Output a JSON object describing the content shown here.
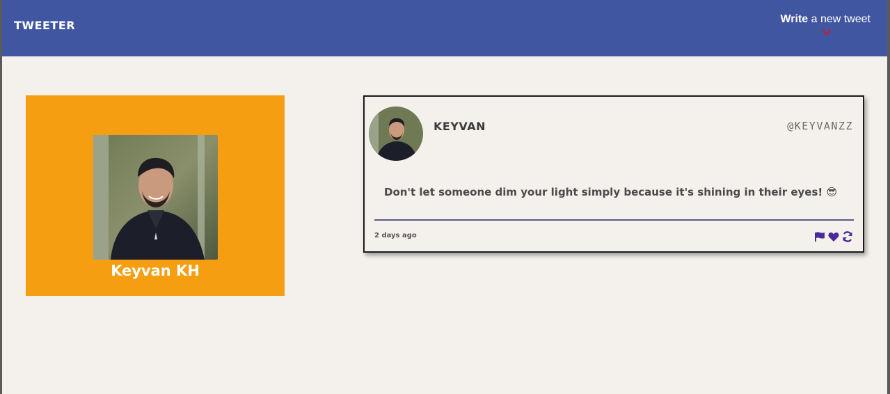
{
  "navbar": {
    "brand": "TWEETER",
    "compose_bold": "Write",
    "compose_rest": " a new tweet",
    "compose_icon": "chevron-down-icon"
  },
  "profile": {
    "name": "Keyvan KH",
    "background_color": "#f59e12"
  },
  "tweet": {
    "name": "KEYVAN",
    "handle": "@KEYVANZZ",
    "text": "Don't let someone dim your light simply because it's shining in their eyes! 😎",
    "time": "2 days ago",
    "actions": [
      "flag-icon",
      "heart-icon",
      "retweet-icon"
    ],
    "accent_color": "#4a2a9a"
  },
  "colors": {
    "navbar": "#4056a1",
    "background": "#f4f1ec",
    "compose_arrow": "#c0203a"
  }
}
